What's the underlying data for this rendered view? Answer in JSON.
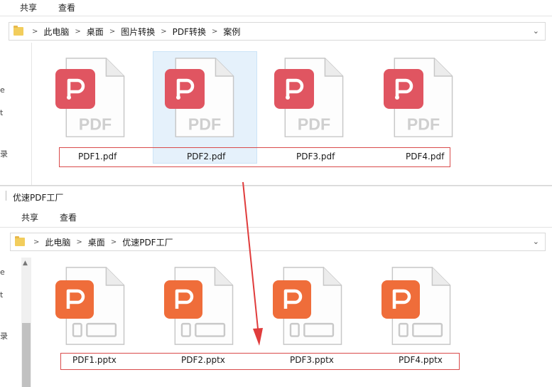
{
  "top_window": {
    "ribbon": {
      "share": "共享",
      "view": "查看"
    },
    "address": {
      "crumbs": [
        "此电脑",
        "桌面",
        "图片转换",
        "PDF转换",
        "案例"
      ],
      "separator": ">"
    },
    "files": [
      {
        "name": "PDF1.pdf",
        "type_text": "PDF"
      },
      {
        "name": "PDF2.pdf",
        "type_text": "PDF",
        "selected": true
      },
      {
        "name": "PDF3.pdf",
        "type_text": "PDF"
      },
      {
        "name": "PDF4.pdf",
        "type_text": "PDF"
      }
    ],
    "sidebar_chars": [
      "e",
      "t",
      "录"
    ]
  },
  "bottom_window": {
    "title": "优速PDF工厂",
    "ribbon": {
      "share": "共享",
      "view": "查看"
    },
    "address": {
      "crumbs": [
        "此电脑",
        "桌面",
        "优速PDF工厂"
      ],
      "separator": ">"
    },
    "files": [
      {
        "name": "PDF1.pptx"
      },
      {
        "name": "PDF2.pptx"
      },
      {
        "name": "PDF3.pptx"
      },
      {
        "name": "PDF4.pptx"
      }
    ],
    "sidebar_chars": [
      "e",
      "t",
      "录"
    ]
  },
  "colors": {
    "pdf_red": "#e05561",
    "ppt_orange": "#ef6d3a",
    "annotation_red": "#e03c3c",
    "selection_blue": "#e5f1fb"
  }
}
